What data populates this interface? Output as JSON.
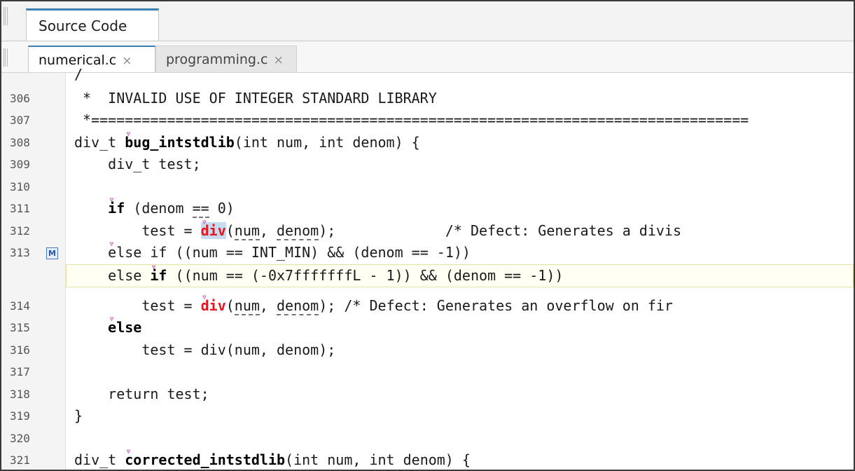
{
  "panel": {
    "title": "Source Code"
  },
  "file_tabs": [
    {
      "label": "numerical.c",
      "close": "×",
      "active": true
    },
    {
      "label": "programming.c",
      "close": "×",
      "active": false
    }
  ],
  "colors": {
    "accent": "#3c7fb1",
    "defect_red": "#e8131f",
    "selection": "#c5dbef",
    "marker": "#c23ab7"
  },
  "editor": {
    "top_fragment": "/",
    "badge": "M",
    "lines": {
      "l306": {
        "num": "306",
        "text": " *  INVALID USE OF INTEGER STANDARD LIBRARY"
      },
      "l307": {
        "num": "307",
        "text": " *=============================================================================="
      },
      "l308": {
        "num": "308",
        "pre": "div_t ",
        "fn": "bug_intstdlib",
        "post": "(int num, int denom) {"
      },
      "l309": {
        "num": "309",
        "text": "    div_t test;"
      },
      "l310": {
        "num": "310",
        "text": ""
      },
      "l311": {
        "num": "311",
        "indent": "    ",
        "kw": "if",
        "mid": " (denom ",
        "op": "==",
        "post": " 0)"
      },
      "l312": {
        "num": "312",
        "indent": "        test = ",
        "fn": "div",
        "open": "(",
        "a1": "num",
        "sep": ", ",
        "a2": "denom",
        "post": ");             /* Defect: Generates a divis"
      },
      "l313": {
        "num": "313",
        "indent": "    ",
        "text": "else if ((num == INT_MIN) && (denom == -1))"
      },
      "inserted": {
        "indent": "    ",
        "pre": "else ",
        "kw": "if",
        "post": " ((num == (-0x7fffffffL - 1)) && (denom == -1))"
      },
      "l314": {
        "num": "314",
        "indent": "        test = ",
        "fn": "div",
        "open": "(",
        "a1": "num",
        "sep": ", ",
        "a2": "denom",
        "post": "); /* Defect: Generates an overflow on fir"
      },
      "l315": {
        "num": "315",
        "indent": "    ",
        "kw": "else"
      },
      "l316": {
        "num": "316",
        "text": "        test = div(num, denom);"
      },
      "l317": {
        "num": "317",
        "text": ""
      },
      "l318": {
        "num": "318",
        "text": "    return test;"
      },
      "l319": {
        "num": "319",
        "text": "}"
      },
      "l320": {
        "num": "320",
        "text": ""
      },
      "l321": {
        "num": "321",
        "pre": "div_t ",
        "fn": "corrected_intstdlib",
        "post": "(int num, int denom) {"
      }
    }
  }
}
